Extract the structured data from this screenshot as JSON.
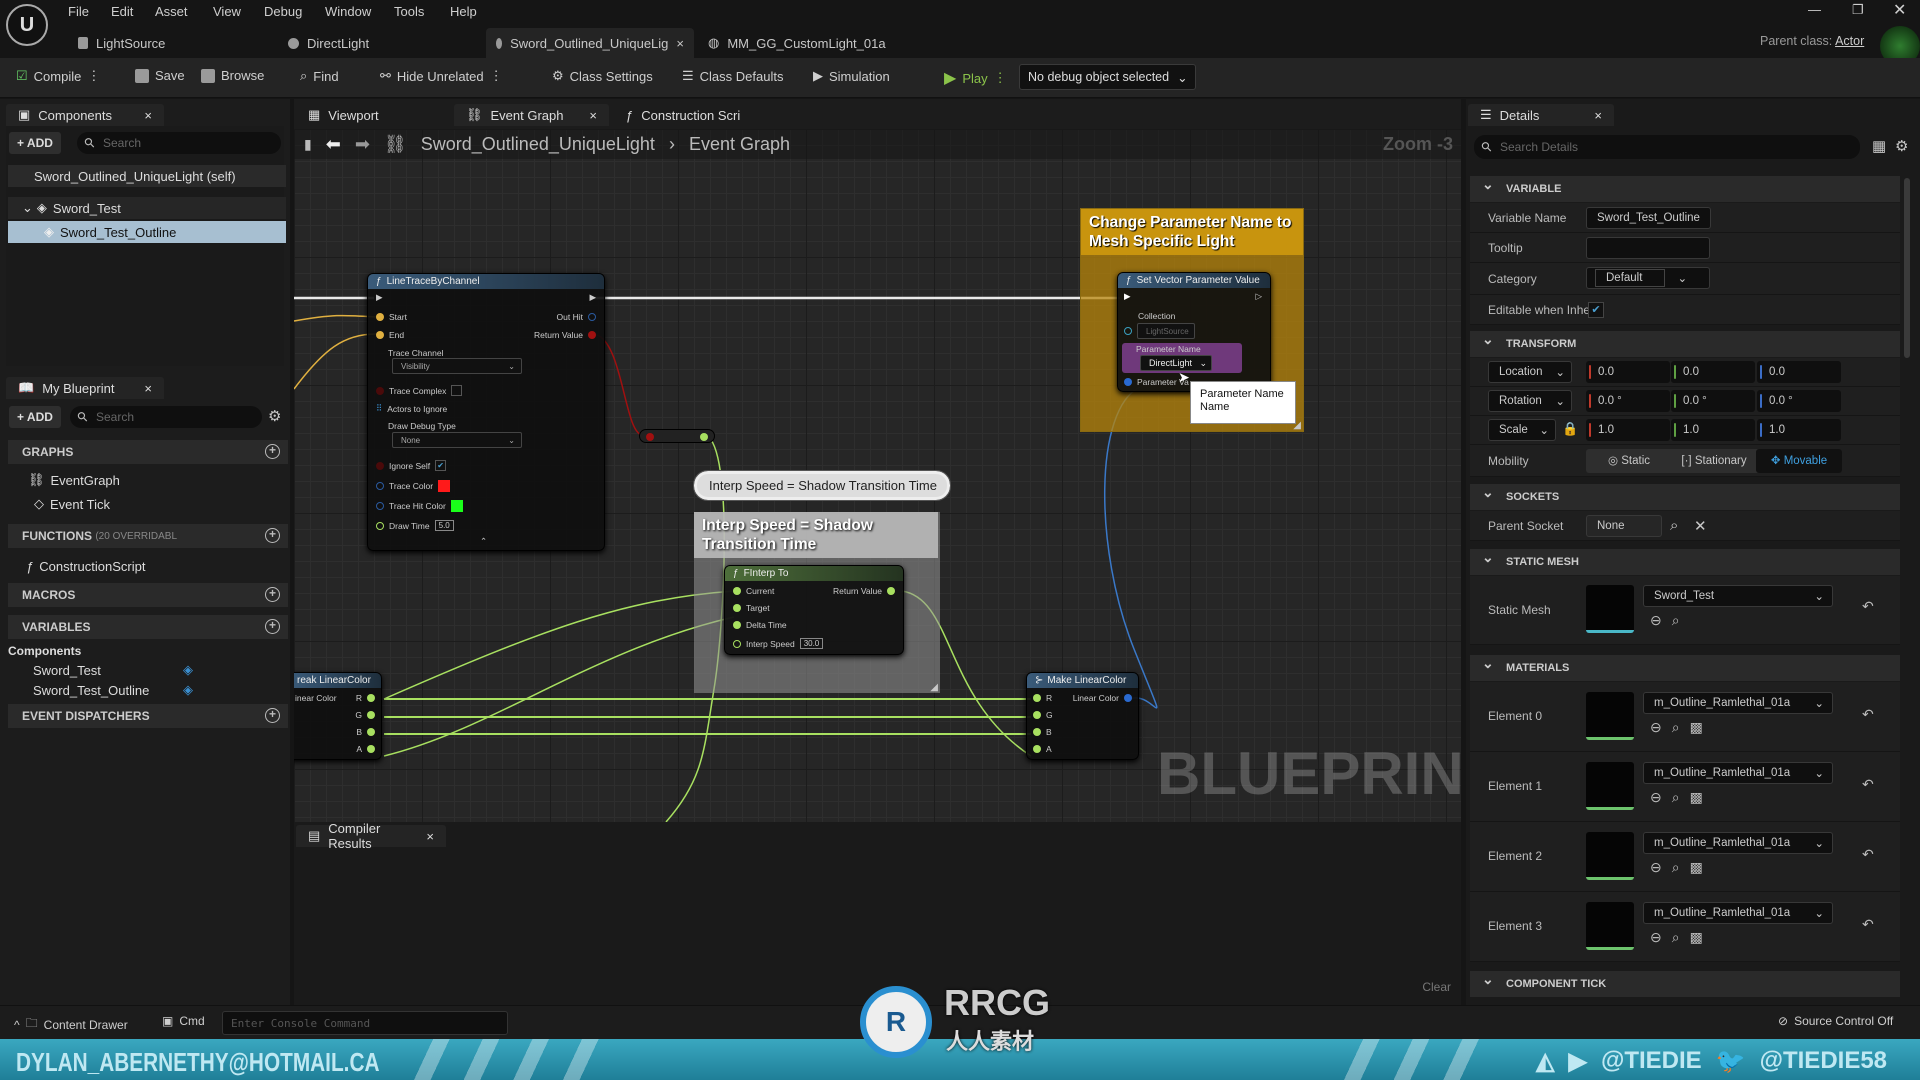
{
  "menu": [
    "File",
    "Edit",
    "Asset",
    "View",
    "Debug",
    "Window",
    "Tools",
    "Help"
  ],
  "doc_tabs": [
    {
      "label": "LightSource",
      "icon": "data-table-icon"
    },
    {
      "label": "DirectLight",
      "icon": "blueprint-icon"
    },
    {
      "label": "Sword_Outlined_UniqueLig",
      "icon": "blueprint-icon",
      "active": true
    },
    {
      "label": "MM_GG_CustomLight_01a",
      "icon": "material-icon"
    }
  ],
  "parent_class": {
    "label": "Parent class:",
    "value": "Actor"
  },
  "toolbar": {
    "compile": "Compile",
    "save": "Save",
    "browse": "Browse",
    "find": "Find",
    "hide_unrelated": "Hide Unrelated",
    "class_settings": "Class Settings",
    "class_defaults": "Class Defaults",
    "simulation": "Simulation",
    "play": "Play",
    "debug_object": "No debug object selected"
  },
  "components": {
    "tab": "Components",
    "add": "+ ADD",
    "search_placeholder": "Search",
    "self": "Sword_Outlined_UniqueLight (self)",
    "items": [
      "Sword_Test",
      "Sword_Test_Outline"
    ]
  },
  "my_blueprint": {
    "tab": "My Blueprint",
    "add": "+ ADD",
    "search_placeholder": "Search",
    "graphs": "GRAPHS",
    "event_graph": "EventGraph",
    "event_tick": "Event Tick",
    "functions": "FUNCTIONS",
    "functions_note": "(20 OVERRIDABL",
    "construction_script": "ConstructionScript",
    "macros": "MACROS",
    "variables": "VARIABLES",
    "var_group": "Components",
    "vars": [
      "Sword_Test",
      "Sword_Test_Outline"
    ],
    "event_dispatchers": "EVENT DISPATCHERS"
  },
  "graph_tabs": [
    "Viewport",
    "Event Graph",
    "Construction Scri"
  ],
  "breadcrumb": {
    "blueprint": "Sword_Outlined_UniqueLight",
    "graph": "Event Graph",
    "zoom": "Zoom -3"
  },
  "watermark": "BLUEPRINT",
  "nodes": {
    "line_trace": {
      "title": "LineTraceByChannel",
      "start": "Start",
      "end": "End",
      "out_hit": "Out Hit",
      "return_value": "Return Value",
      "trace_channel": "Trace Channel",
      "trace_channel_value": "Visibility",
      "trace_complex": "Trace Complex",
      "actors_to_ignore": "Actors to Ignore",
      "draw_debug_type": "Draw Debug Type",
      "draw_debug_value": "None",
      "ignore_self": "Ignore Self",
      "trace_color": "Trace Color",
      "trace_hit_color": "Trace Hit Color",
      "draw_time": "Draw Time",
      "draw_time_value": "5.0",
      "trace_color_hex": "#ff1a1a",
      "trace_hit_color_hex": "#1aff1a"
    },
    "comment_yellow": "Change Parameter Name to Mesh Specific Light",
    "set_vector": {
      "title": "Set Vector Parameter Value",
      "collection": "Collection",
      "collection_value": "LightSource",
      "parameter_name": "Parameter Name",
      "parameter_value": "DirectLight",
      "parameter_val_label": "Parameter Va"
    },
    "tooltip": "Parameter Name Name",
    "bubble": "Interp Speed = Shadow Transition Time",
    "comment_gray": "Interp Speed = Shadow Transition Time",
    "finterp": {
      "title": "FInterp To",
      "current": "Current",
      "target": "Target",
      "delta_time": "Delta Time",
      "interp_speed": "Interp Speed",
      "interp_speed_value": "30.0",
      "return_value": "Return Value"
    },
    "break_color": {
      "title": "reak LinearColor",
      "input": "inear Color",
      "pins": [
        "R",
        "G",
        "B",
        "A"
      ]
    },
    "make_color": {
      "title": "Make LinearColor",
      "output": "Linear Color",
      "pins": [
        "R",
        "G",
        "B",
        "A"
      ]
    }
  },
  "compiler": {
    "tab": "Compiler Results",
    "clear": "Clear"
  },
  "details": {
    "tab": "Details",
    "search_placeholder": "Search Details",
    "variable": {
      "header": "VARIABLE",
      "name_label": "Variable Name",
      "name_value": "Sword_Test_Outline",
      "tooltip_label": "Tooltip",
      "tooltip_value": "",
      "category_label": "Category",
      "category_value": "Default",
      "editable_label": "Editable when Inhe",
      "editable": true
    },
    "transform": {
      "header": "TRANSFORM",
      "location": "Location",
      "location_values": [
        "0.0",
        "0.0",
        "0.0"
      ],
      "rotation": "Rotation",
      "rotation_values": [
        "0.0 °",
        "0.0 °",
        "0.0 °"
      ],
      "scale": "Scale",
      "scale_values": [
        "1.0",
        "1.0",
        "1.0"
      ],
      "mobility_label": "Mobility",
      "mobility_options": [
        "Static",
        "Stationary",
        "Movable"
      ],
      "mobility_selected": "Movable"
    },
    "sockets": {
      "header": "SOCKETS",
      "parent_label": "Parent Socket",
      "parent_value": "None"
    },
    "static_mesh": {
      "header": "STATIC MESH",
      "label": "Static Mesh",
      "value": "Sword_Test"
    },
    "materials": {
      "header": "MATERIALS",
      "elements": [
        {
          "label": "Element 0",
          "value": "m_Outline_Ramlethal_01a"
        },
        {
          "label": "Element 1",
          "value": "m_Outline_Ramlethal_01a"
        },
        {
          "label": "Element 2",
          "value": "m_Outline_Ramlethal_01a"
        },
        {
          "label": "Element 3",
          "value": "m_Outline_Ramlethal_01a"
        }
      ]
    },
    "component_tick": {
      "header": "COMPONENT TICK"
    }
  },
  "statusbar": {
    "content_drawer": "Content Drawer",
    "cmd": "Cmd",
    "console_placeholder": "Enter Console Command",
    "source_control": "Source Control Off"
  },
  "banner": {
    "email": "DYLAN_ABERNETHY@HOTMAIL.CA",
    "handle1": "@TIEDIE",
    "handle2": "@TIEDIE58",
    "logo_text": "RRCG",
    "logo_sub": "人人素材"
  },
  "colors": {
    "exec_wire": "#e8e8e8",
    "float_wire": "#a8e060",
    "vector_wire": "#e0b040",
    "struct_wire": "#3a78c8",
    "comment_yellow": "#b8860b",
    "accent": "#3fa0e0"
  }
}
